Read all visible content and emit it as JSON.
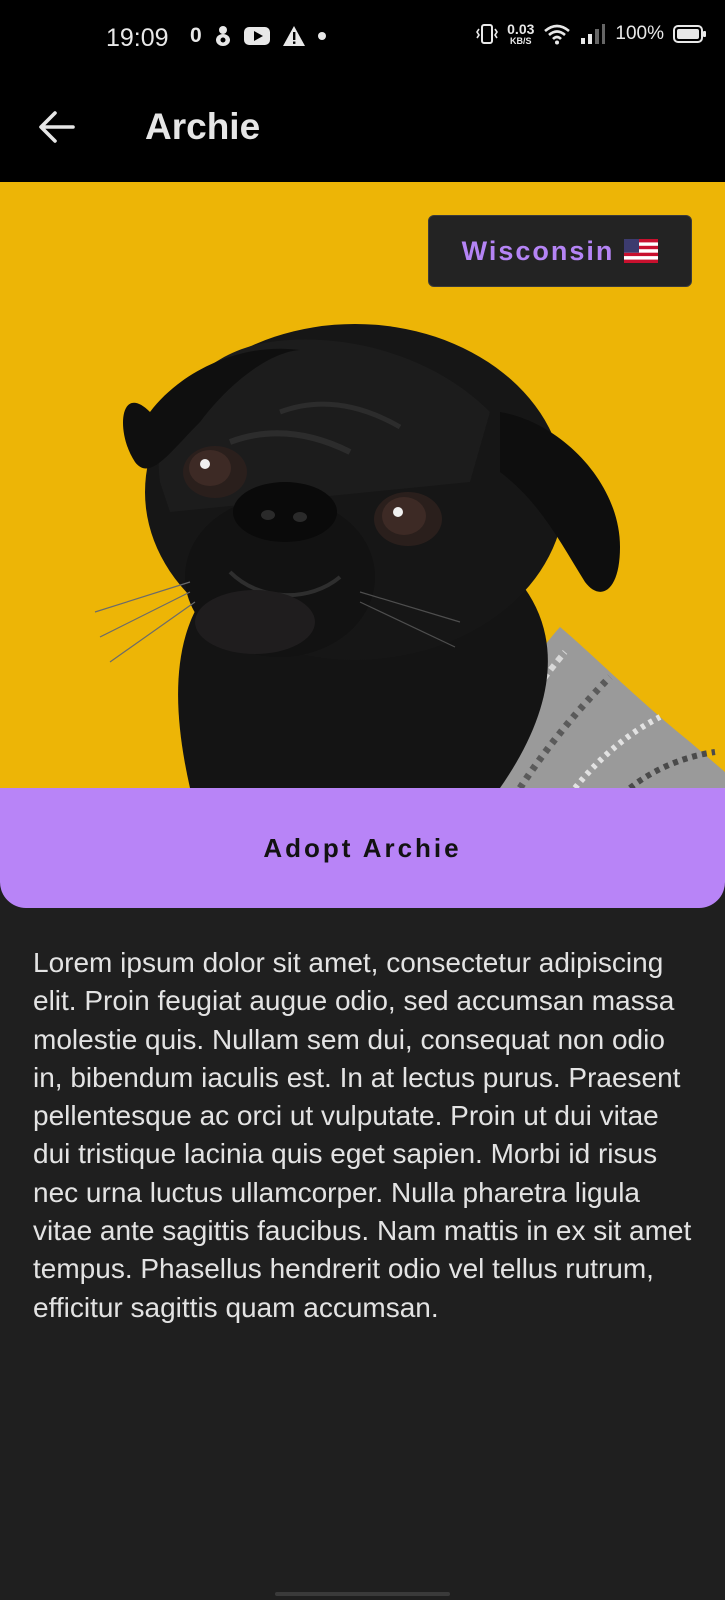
{
  "status_bar": {
    "time": "19:09",
    "notification_count": "0",
    "notification_icons": [
      "bug-icon",
      "youtube-icon",
      "warning-icon",
      "dot-icon"
    ],
    "speed_value": "0.03",
    "speed_unit": "KB/S",
    "battery_percent": "100%",
    "right_icons": [
      "vibrate-icon",
      "wifi-icon",
      "signal-icon",
      "battery-icon"
    ]
  },
  "app_bar": {
    "title": "Archie",
    "back_icon": "arrow-back-icon"
  },
  "hero": {
    "background_color": "#edb506",
    "location_label": "Wisconsin",
    "location_flag": "us-flag-icon"
  },
  "adopt_button": {
    "label": "Adopt Archie",
    "color": "#b884f7"
  },
  "description": {
    "text": "Lorem ipsum dolor sit amet, consectetur adipiscing elit. Proin feugiat augue odio, sed accumsan massa molestie quis. Nullam sem dui, consequat non odio in, bibendum iaculis est. In at lectus purus. Praesent pellentesque ac orci ut vulputate. Proin ut dui vitae dui tristique lacinia quis eget sapien. Morbi id risus nec urna luctus ullamcorper. Nulla pharetra ligula vitae ante sagittis faucibus. Nam mattis in ex sit amet tempus. Phasellus hendrerit odio vel tellus rutrum, efficitur sagittis quam accumsan."
  },
  "colors": {
    "accent": "#b584f5",
    "background": "#1f1f1f",
    "app_bar": "#000000"
  }
}
